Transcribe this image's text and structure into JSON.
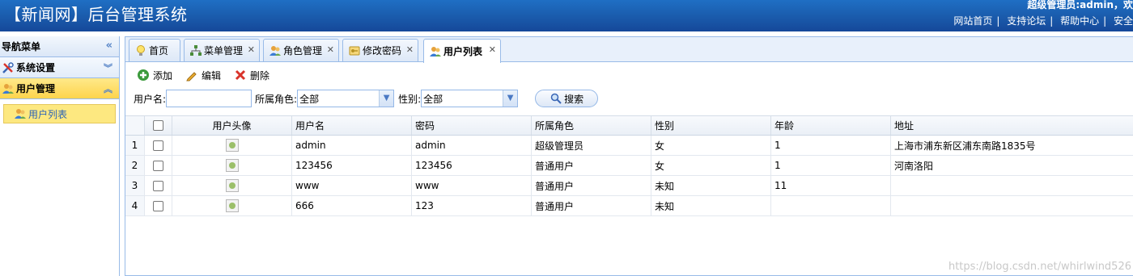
{
  "header": {
    "title": "【新闻网】后台管理系统",
    "welcome": "超级管理员:admin，欢",
    "links": [
      "网站首页",
      "支持论坛",
      "帮助中心",
      "安全"
    ]
  },
  "sidebar": {
    "title": "导航菜单",
    "sections": [
      {
        "label": "系统设置",
        "icon": "tools-icon",
        "active": false
      },
      {
        "label": "用户管理",
        "icon": "users-icon",
        "active": true
      }
    ],
    "items": [
      {
        "label": "用户列表",
        "icon": "users-icon"
      }
    ]
  },
  "tabs": [
    {
      "label": "首页",
      "icon": "bulb-icon",
      "closable": false
    },
    {
      "label": "菜单管理",
      "icon": "tree-icon",
      "closable": true
    },
    {
      "label": "角色管理",
      "icon": "users-icon",
      "closable": true
    },
    {
      "label": "修改密码",
      "icon": "key-icon",
      "closable": true
    },
    {
      "label": "用户列表",
      "icon": "users-icon",
      "closable": true,
      "active": true
    }
  ],
  "toolbar": {
    "add": "添加",
    "edit": "编辑",
    "delete": "删除"
  },
  "search": {
    "username_label": "用户名:",
    "username_value": "",
    "role_label": "所属角色:",
    "role_value": "全部",
    "sex_label": "性别:",
    "sex_value": "全部",
    "search_button": "搜索"
  },
  "grid": {
    "columns": [
      "用户头像",
      "用户名",
      "密码",
      "所属角色",
      "性别",
      "年龄",
      "地址"
    ],
    "rows": [
      {
        "num": "1",
        "username": "admin",
        "password": "admin",
        "role": "超级管理员",
        "sex": "女",
        "age": "1",
        "address": "上海市浦东新区浦东南路1835号"
      },
      {
        "num": "2",
        "username": "123456",
        "password": "123456",
        "role": "普通用户",
        "sex": "女",
        "age": "1",
        "address": "河南洛阳"
      },
      {
        "num": "3",
        "username": "www",
        "password": "www",
        "role": "普通用户",
        "sex": "未知",
        "age": "11",
        "address": ""
      },
      {
        "num": "4",
        "username": "666",
        "password": "123",
        "role": "普通用户",
        "sex": "未知",
        "age": "",
        "address": ""
      }
    ]
  },
  "watermark": "https://blog.csdn.net/whirlwind526",
  "colors": {
    "header": "#1a5aab",
    "border": "#99bbe8",
    "active": "#fdd44c"
  }
}
